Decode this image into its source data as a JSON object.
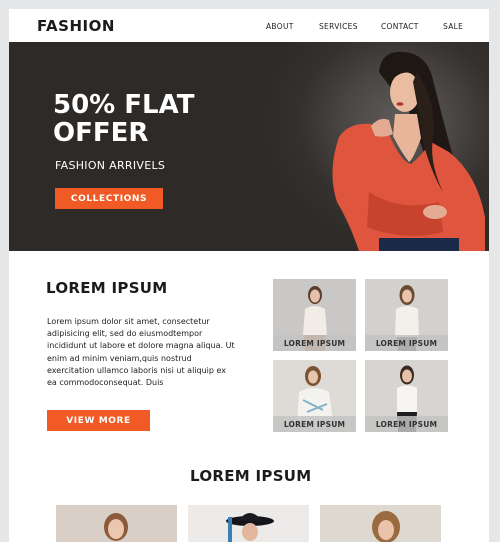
{
  "header": {
    "logo": "FASHION",
    "nav": [
      "ABOUT",
      "SERVICES",
      "CONTACT",
      "SALE"
    ]
  },
  "hero": {
    "title": "50% FLAT OFFER",
    "subtitle": "FASHION ARRIVELS",
    "button": "COLLECTIONS"
  },
  "section1": {
    "title": "LOREM IPSUM",
    "body": "Lorem ipsum dolor sit amet, consectetur adipisicing elit, sed do eiusmodtempor incididunt ut labore et dolore magna aliqua. Ut enim ad minim veniam,quis nostrud exercitation ullamco laboris nisi ut aliquip ex ea commodoconsequat. Duis",
    "button": "VIEW MORE",
    "gallery": [
      {
        "caption": "LOREM IPSUM"
      },
      {
        "caption": "LOREM IPSUM"
      },
      {
        "caption": "LOREM IPSUM"
      },
      {
        "caption": "LOREM IPSUM"
      }
    ]
  },
  "section2": {
    "title": "LOREM IPSUM"
  },
  "colors": {
    "accent": "#f15a24",
    "hero_bg": "#2d2a28"
  }
}
